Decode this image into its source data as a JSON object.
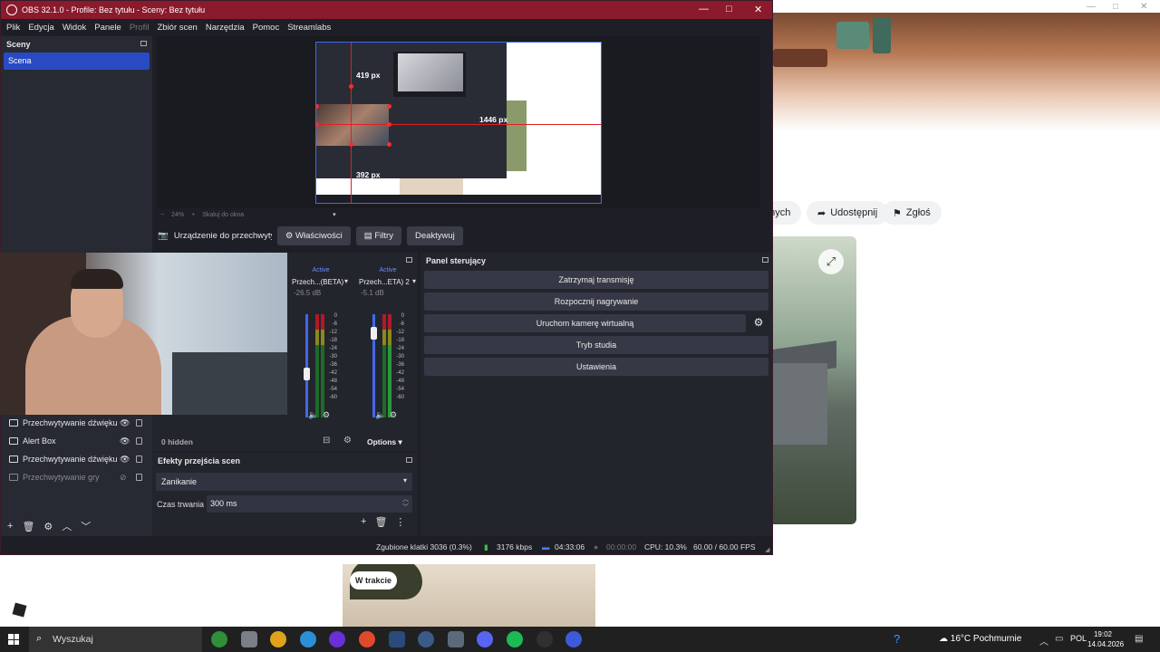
{
  "obs": {
    "title": "OBS 32.1.0 - Profile: Bez tytułu - Sceny: Bez tytułu",
    "menu": [
      "Plik",
      "Edycja",
      "Widok",
      "Panele",
      "Profil",
      "Zbiór scen",
      "Narzędzia",
      "Pomoc",
      "Streamlabs"
    ],
    "scenes": {
      "title": "Sceny",
      "items": [
        "Scena"
      ]
    },
    "preview": {
      "labels": {
        "top": "419 px",
        "right": "1446 px",
        "bottom": "392 px"
      },
      "zoom": "24%",
      "scale_label": "Skaluj do okna"
    },
    "source_toolbar": {
      "selected_source": "Urządzenie do przechwytywania",
      "properties": "Właściwości",
      "filters": "Filtry",
      "deactivate": "Deaktywuj"
    },
    "mixer": {
      "channels": [
        {
          "status": "Active",
          "name": "Przech...(BETA)",
          "db": "-26.5 dB",
          "level": 0.42
        },
        {
          "status": "Active",
          "name": "Przech...ETA) 2",
          "db": "-5.1 dB",
          "level": 0.82
        }
      ],
      "scale": [
        "0",
        "-6",
        "-12",
        "-18",
        "-24",
        "-30",
        "-36",
        "-42",
        "-48",
        "-54",
        "-60"
      ],
      "hidden": "0 hidden",
      "options": "Options"
    },
    "sources": {
      "items": [
        {
          "name": "Przechwytywanie dźwięku",
          "dimmed": false
        },
        {
          "name": "Alert Box",
          "dimmed": false
        },
        {
          "name": "Przechwytywanie dźwięku",
          "dimmed": false
        },
        {
          "name": "Przechwytywanie gry",
          "dimmed": true
        }
      ]
    },
    "transitions": {
      "title": "Efekty przejścia scen",
      "selected": "Zanikanie",
      "duration_label": "Czas trwania",
      "duration_value": "300 ms"
    },
    "controls": {
      "title": "Panel sterujący",
      "buttons": [
        "Zatrzymaj transmisję",
        "Rozpocznij nagrywanie",
        "Uruchom kamerę wirtualną",
        "Tryb studia",
        "Ustawienia"
      ]
    },
    "status": {
      "dropped": "Zgubione klatki 3036 (0.3%)",
      "bitrate": "3176 kbps",
      "stream_time": "04:33:06",
      "rec_time": "00:00:00",
      "cpu": "CPU: 10.3%",
      "fps": "60.00 / 60.00 FPS"
    }
  },
  "browser": {
    "partial_button": "onych",
    "share": "Udostępnij",
    "report": "Zgłoś",
    "badge": "W trakcie"
  },
  "taskbar": {
    "search_placeholder": "Wyszukaj",
    "weather": "16°C Pochmurnie",
    "lang": "POL",
    "time": "19:02",
    "date": "14.04.2026",
    "apps": [
      {
        "icon": "xbox-icon",
        "color": "#2f8f3a"
      },
      {
        "icon": "game-icon",
        "color": "#7a7f88"
      },
      {
        "icon": "chrome-icon",
        "color": "#e0a21a"
      },
      {
        "icon": "edge-icon",
        "color": "#2b8fd6"
      },
      {
        "icon": "app-icon",
        "color": "#6b2fd6"
      },
      {
        "icon": "app-icon",
        "color": "#e04a2a"
      },
      {
        "icon": "steam-icon",
        "color": "#2a4a7a"
      },
      {
        "icon": "app-icon",
        "color": "#3a5a8a"
      },
      {
        "icon": "calculator-icon",
        "color": "#5a6a7a"
      },
      {
        "icon": "discord-icon",
        "color": "#5865f2"
      },
      {
        "icon": "spotify-icon",
        "color": "#1db954"
      },
      {
        "icon": "obs-icon",
        "color": "#303030"
      },
      {
        "icon": "app-icon",
        "color": "#3b5bdb"
      }
    ]
  }
}
